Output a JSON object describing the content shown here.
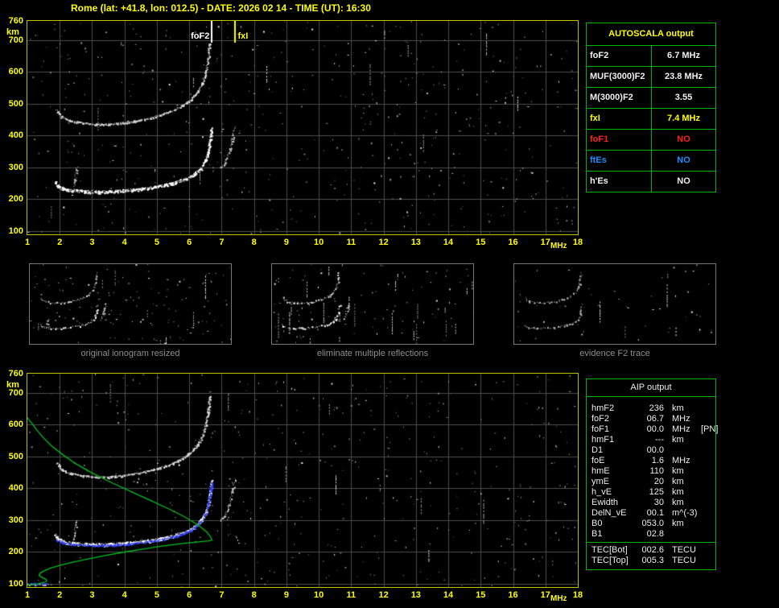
{
  "header": {
    "title": "Rome (lat: +41.8, lon: 012.5) - DATE: 2026 02 14 - TIME (UT): 16:30"
  },
  "colors": {
    "background": "#000000",
    "title": "#ffff00",
    "axis_labels": "#ffff00",
    "plot_frame": "#c0c000",
    "grid": "#4c4c4c",
    "table_border": "#00b400",
    "autoscala_header": "#ffff00",
    "aip_text": "#ededed",
    "caption": "#8f8f8f",
    "trace_white": "#ffffff",
    "trace_blue": "#2b3cff",
    "profile_green": "#00c020",
    "marker_fof2": "#ffffff",
    "marker_fxi": "#ffff00",
    "status_red": "#ff2020",
    "status_blue": "#1e90ff"
  },
  "autoscala": {
    "header": "AUTOSCALA output",
    "rows": [
      {
        "label": "foF2",
        "value": "6.7 MHz",
        "color": "#f0f0f0"
      },
      {
        "label": "MUF(3000)F2",
        "value": "23.8 MHz",
        "color": "#f0f0f0"
      },
      {
        "label": "M(3000)F2",
        "value": "3.55",
        "color": "#f0f0f0"
      },
      {
        "label": "fxI",
        "value": "7.4 MHz",
        "color": "#ffff00"
      },
      {
        "label": "foF1",
        "value": "NO",
        "color": "#ff2020"
      },
      {
        "label": "ftEs",
        "value": "NO",
        "color": "#1e90ff"
      },
      {
        "label": "h'Es",
        "value": "NO",
        "color": "#f0f0f0"
      }
    ]
  },
  "aip": {
    "header": "AIP output",
    "rows": [
      {
        "label": "hmF2",
        "value": "236",
        "unit": "km",
        "extra": ""
      },
      {
        "label": "foF2",
        "value": "06.7",
        "unit": "MHz",
        "extra": ""
      },
      {
        "label": "foF1",
        "value": "00.0",
        "unit": "MHz",
        "extra": "[PN]"
      },
      {
        "label": "hmF1",
        "value": "---",
        "unit": "km",
        "extra": ""
      },
      {
        "label": "D1",
        "value": "00.0",
        "unit": "",
        "extra": ""
      },
      {
        "label": "foE",
        "value": "1.6",
        "unit": "MHz",
        "extra": ""
      },
      {
        "label": "hmE",
        "value": "110",
        "unit": "km",
        "extra": ""
      },
      {
        "label": "ymE",
        "value": "20",
        "unit": "km",
        "extra": ""
      },
      {
        "label": "h_vE",
        "value": "125",
        "unit": "km",
        "extra": ""
      },
      {
        "label": "Ewidth",
        "value": "30",
        "unit": "km",
        "extra": ""
      },
      {
        "label": "DelN_vE",
        "value": "00.1",
        "unit": "m^(-3)",
        "extra": ""
      },
      {
        "label": "B0",
        "value": "053.0",
        "unit": "km",
        "extra": ""
      },
      {
        "label": "B1",
        "value": "02.8",
        "unit": "",
        "extra": ""
      }
    ],
    "tec_rows": [
      {
        "label": "TEC[Bot]",
        "value": "002.6",
        "unit": "TECU"
      },
      {
        "label": "TEC[Top]",
        "value": "005.3",
        "unit": "TECU"
      }
    ]
  },
  "thumbnails": [
    {
      "caption": "original ionogram resized",
      "series": [
        "F2 trace",
        "multiple reflection",
        "X-mode tail",
        "F1 cusp"
      ],
      "noise_dots": 130,
      "rfi_streaks": 8,
      "seed": 21,
      "mono": ""
    },
    {
      "caption": "eliminate multiple reflections",
      "series": [
        "F2 trace",
        "multiple reflection",
        "X-mode tail"
      ],
      "noise_dots": 95,
      "rfi_streaks": 24,
      "seed": 22,
      "mono": ""
    },
    {
      "caption": "evidence F2 trace",
      "series": [
        "F2 trace",
        "multiple reflection"
      ],
      "noise_dots": 50,
      "rfi_streaks": 5,
      "seed": 23,
      "mono": "#b8b8b8"
    }
  ],
  "axes": {
    "x_ticks": [
      1,
      2,
      3,
      4,
      5,
      6,
      7,
      8,
      9,
      10,
      11,
      12,
      13,
      14,
      15,
      16,
      17,
      18
    ],
    "x_unit": "MHz",
    "y_ticks": [
      760,
      700,
      600,
      500,
      400,
      300,
      200,
      100
    ],
    "y_unit": "km",
    "xlim": [
      1,
      18
    ],
    "ylim": [
      90,
      760
    ]
  },
  "chart_data": [
    {
      "id": "recorded_ionogram",
      "type": "scatter",
      "title": "recorded ionogram with AUTOSCALA markers",
      "xlabel": "MHz",
      "ylabel": "km",
      "xlim": [
        1,
        18
      ],
      "ylim": [
        90,
        760
      ],
      "grid": true,
      "noise_dots": 560,
      "rfi_streaks": 13,
      "seed": 1402,
      "annotations": [
        {
          "text": "foF2",
          "x": 6.7,
          "color": "#ffffff"
        },
        {
          "text": "fxI",
          "x": 7.4,
          "color": "#ffff00"
        }
      ],
      "series": [
        {
          "name": "F2 trace",
          "color": "#ffffff",
          "weight": 3,
          "points": [
            [
              1.85,
              253
            ],
            [
              1.95,
              241
            ],
            [
              2.1,
              233
            ],
            [
              2.4,
              228
            ],
            [
              2.8,
              225
            ],
            [
              3.2,
              224
            ],
            [
              3.6,
              225
            ],
            [
              4.0,
              228
            ],
            [
              4.4,
              232
            ],
            [
              4.8,
              237
            ],
            [
              5.2,
              244
            ],
            [
              5.6,
              254
            ],
            [
              5.9,
              265
            ],
            [
              6.15,
              279
            ],
            [
              6.35,
              298
            ],
            [
              6.5,
              322
            ],
            [
              6.58,
              350
            ],
            [
              6.63,
              380
            ],
            [
              6.66,
              404
            ],
            [
              6.68,
              422
            ]
          ]
        },
        {
          "name": "multiple reflection",
          "color": "#d9d9d9",
          "weight": 2,
          "points": [
            [
              1.9,
              480
            ],
            [
              2.05,
              460
            ],
            [
              2.3,
              448
            ],
            [
              2.7,
              440
            ],
            [
              3.1,
              436
            ],
            [
              3.5,
              436
            ],
            [
              3.9,
              440
            ],
            [
              4.3,
              446
            ],
            [
              4.7,
              454
            ],
            [
              5.1,
              465
            ],
            [
              5.5,
              480
            ],
            [
              5.8,
              496
            ],
            [
              6.05,
              514
            ],
            [
              6.25,
              538
            ],
            [
              6.4,
              565
            ],
            [
              6.5,
              598
            ],
            [
              6.58,
              642
            ],
            [
              6.62,
              690
            ]
          ]
        },
        {
          "name": "X-mode tail",
          "color": "#c8c8c8",
          "weight": 1,
          "points": [
            [
              6.95,
              298
            ],
            [
              7.1,
              318
            ],
            [
              7.22,
              348
            ],
            [
              7.32,
              388
            ],
            [
              7.4,
              428
            ]
          ]
        },
        {
          "name": "F1 cusp",
          "color": "#c0c0c0",
          "weight": 1,
          "points": [
            [
              2.42,
              236
            ],
            [
              2.46,
              260
            ],
            [
              2.49,
              282
            ],
            [
              2.52,
              302
            ]
          ]
        }
      ]
    },
    {
      "id": "restored_ionogram",
      "type": "scatter",
      "title": "ionogram with restored trace and plasma frequency profile",
      "xlabel": "MHz",
      "ylabel": "km",
      "xlim": [
        1,
        18
      ],
      "ylim": [
        90,
        760
      ],
      "grid": true,
      "noise_dots": 500,
      "rfi_streaks": 10,
      "seed": 1630,
      "annotations": [],
      "series": [
        {
          "name": "F2 trace",
          "color": "#ffffff",
          "weight": 3,
          "points": [
            [
              1.85,
              253
            ],
            [
              1.95,
              241
            ],
            [
              2.1,
              233
            ],
            [
              2.4,
              228
            ],
            [
              2.8,
              225
            ],
            [
              3.2,
              224
            ],
            [
              3.6,
              225
            ],
            [
              4.0,
              228
            ],
            [
              4.4,
              232
            ],
            [
              4.8,
              237
            ],
            [
              5.2,
              244
            ],
            [
              5.6,
              254
            ],
            [
              5.9,
              265
            ],
            [
              6.15,
              279
            ],
            [
              6.35,
              298
            ],
            [
              6.5,
              322
            ],
            [
              6.58,
              350
            ],
            [
              6.63,
              380
            ],
            [
              6.66,
              404
            ],
            [
              6.68,
              422
            ]
          ]
        },
        {
          "name": "multiple reflection",
          "color": "#d9d9d9",
          "weight": 2,
          "points": [
            [
              1.9,
              480
            ],
            [
              2.05,
              460
            ],
            [
              2.3,
              448
            ],
            [
              2.7,
              440
            ],
            [
              3.1,
              436
            ],
            [
              3.5,
              436
            ],
            [
              3.9,
              440
            ],
            [
              4.3,
              446
            ],
            [
              4.7,
              454
            ],
            [
              5.1,
              465
            ],
            [
              5.5,
              480
            ],
            [
              5.8,
              496
            ],
            [
              6.05,
              514
            ],
            [
              6.25,
              538
            ],
            [
              6.4,
              565
            ],
            [
              6.5,
              598
            ],
            [
              6.58,
              642
            ],
            [
              6.62,
              690
            ]
          ]
        },
        {
          "name": "X-mode tail",
          "color": "#c8c8c8",
          "weight": 1,
          "points": [
            [
              6.95,
              298
            ],
            [
              7.1,
              318
            ],
            [
              7.22,
              348
            ],
            [
              7.32,
              388
            ],
            [
              7.4,
              428
            ]
          ]
        },
        {
          "name": "F1 cusp",
          "color": "#c0c0c0",
          "weight": 1,
          "points": [
            [
              2.42,
              236
            ],
            [
              2.46,
              260
            ],
            [
              2.49,
              282
            ],
            [
              2.52,
              302
            ]
          ]
        },
        {
          "name": "E echo",
          "color": "#bdbdbd",
          "weight": 1,
          "points": [
            [
              1.0,
              100
            ],
            [
              1.2,
              99
            ],
            [
              1.45,
              99
            ],
            [
              1.65,
              101
            ]
          ]
        },
        {
          "name": "restored F2 trace",
          "color": "#2b3cff",
          "weight": 2,
          "points": [
            [
              1.9,
              238
            ],
            [
              2.1,
              230
            ],
            [
              2.4,
              225
            ],
            [
              2.8,
              222
            ],
            [
              3.2,
              221
            ],
            [
              3.6,
              222
            ],
            [
              4.0,
              225
            ],
            [
              4.4,
              229
            ],
            [
              4.8,
              234
            ],
            [
              5.2,
              241
            ],
            [
              5.6,
              251
            ],
            [
              5.9,
              262
            ],
            [
              6.15,
              276
            ],
            [
              6.35,
              295
            ],
            [
              6.5,
              319
            ],
            [
              6.58,
              346
            ],
            [
              6.63,
              376
            ],
            [
              6.66,
              400
            ],
            [
              6.68,
              418
            ]
          ]
        },
        {
          "name": "restored E trace",
          "color": "#2b3cff",
          "weight": 1,
          "points": [
            [
              1.0,
              104
            ],
            [
              1.15,
              102
            ],
            [
              1.3,
              101
            ],
            [
              1.45,
              102
            ],
            [
              1.58,
              105
            ]
          ]
        },
        {
          "name": "plasma frequency profile",
          "color": "#00c020",
          "style": "line",
          "points": [
            [
              1.0,
              96
            ],
            [
              1.3,
              100
            ],
            [
              1.5,
              104
            ],
            [
              1.6,
              109
            ],
            [
              1.58,
              114
            ],
            [
              1.5,
              118
            ],
            [
              1.42,
              122
            ],
            [
              1.36,
              127
            ],
            [
              1.4,
              134
            ],
            [
              1.52,
              141
            ],
            [
              1.7,
              149
            ],
            [
              2.0,
              158
            ],
            [
              2.4,
              168
            ],
            [
              2.9,
              179
            ],
            [
              3.4,
              189
            ],
            [
              4.0,
              200
            ],
            [
              4.6,
              210
            ],
            [
              5.2,
              219
            ],
            [
              5.8,
              227
            ],
            [
              6.3,
              232
            ],
            [
              6.6,
              235
            ],
            [
              6.7,
              237
            ],
            [
              6.67,
              246
            ],
            [
              6.55,
              262
            ],
            [
              6.3,
              283
            ],
            [
              5.9,
              308
            ],
            [
              5.4,
              334
            ],
            [
              4.8,
              362
            ],
            [
              4.2,
              390
            ],
            [
              3.6,
              418
            ],
            [
              3.0,
              448
            ],
            [
              2.5,
              477
            ],
            [
              2.1,
              505
            ],
            [
              1.75,
              533
            ],
            [
              1.5,
              558
            ],
            [
              1.3,
              582
            ],
            [
              1.15,
              603
            ],
            [
              1.05,
              615
            ],
            [
              1.0,
              622
            ]
          ]
        }
      ]
    }
  ]
}
